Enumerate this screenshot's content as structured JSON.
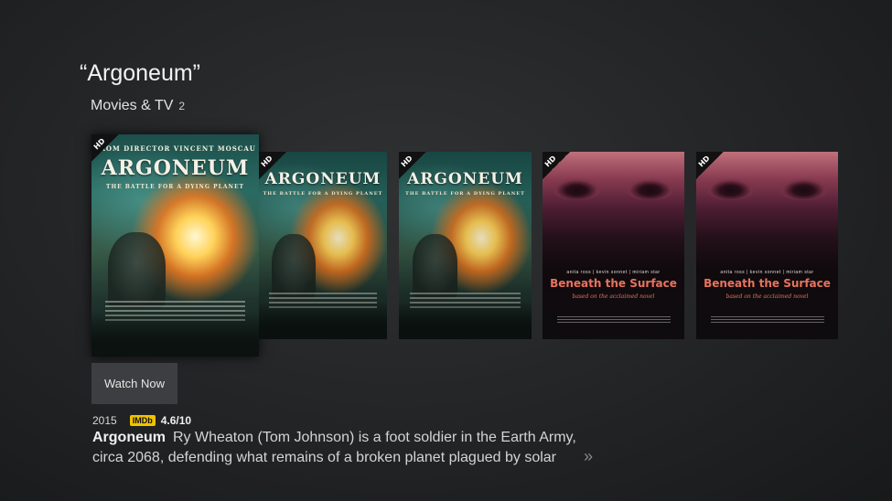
{
  "search": {
    "query": "“Argoneum”"
  },
  "section": {
    "title": "Movies & TV",
    "count": "2"
  },
  "posters": [
    {
      "badge": "HD",
      "tagline": "FROM DIRECTOR VINCENT MOSCAU",
      "title": "ARGONEUM",
      "subtitle": "THE BATTLE FOR A DYING PLANET"
    },
    {
      "badge": "HD",
      "title": "ARGONEUM",
      "subtitle": "THE BATTLE FOR A DYING PLANET"
    },
    {
      "badge": "HD",
      "title": "ARGONEUM",
      "subtitle": "THE BATTLE FOR A DYING PLANET"
    },
    {
      "badge": "HD",
      "credits": "anita ross  |  kevin sonnet  |  miriam star",
      "title": "Beneath the Surface",
      "subtitle": "based on the acclaimed novel"
    },
    {
      "badge": "HD",
      "credits": "anita ross  |  kevin sonnet  |  miriam star",
      "title": "Beneath the Surface",
      "subtitle": "based on the acclaimed novel"
    }
  ],
  "actions": {
    "watch_now": "Watch Now"
  },
  "details": {
    "year": "2015",
    "imdb_label": "IMDb",
    "rating": "4.6/10",
    "title": "Argoneum",
    "description": "Ry Wheaton (Tom Johnson) is a foot soldier in the Earth Army, circa 2068, defending what remains of a broken planet plagued by solar",
    "more_icon": "double-chevron-right-icon",
    "more_glyph": "»"
  }
}
